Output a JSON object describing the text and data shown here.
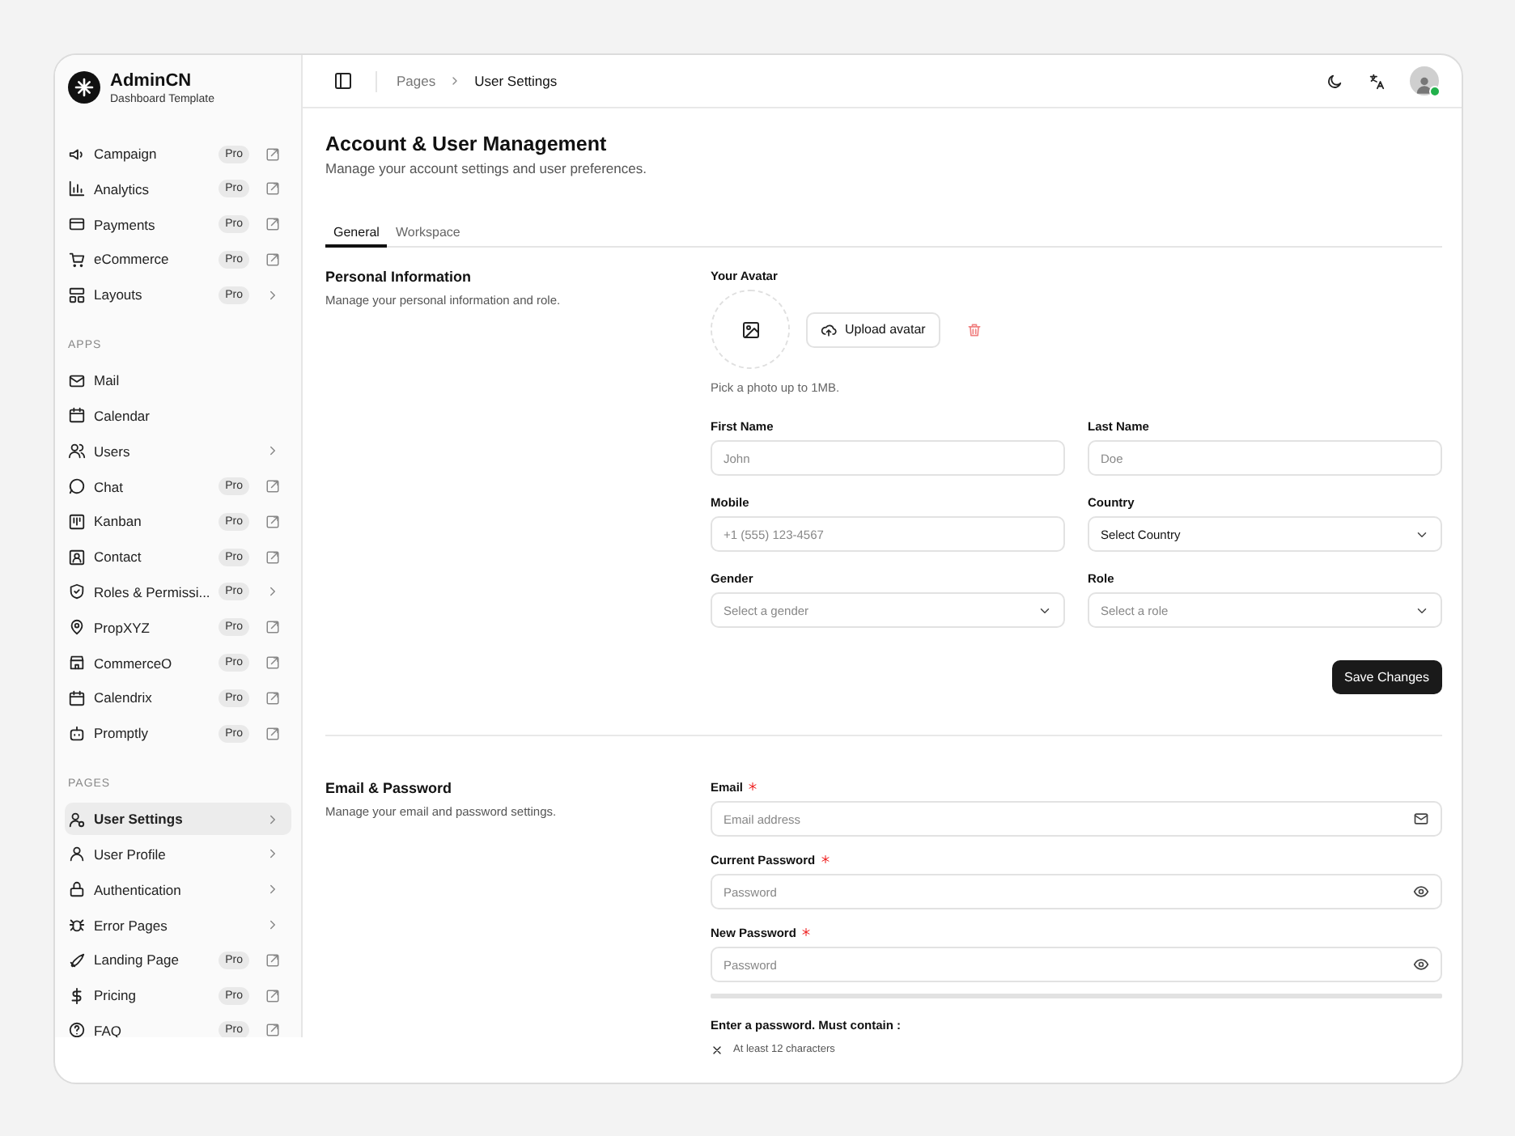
{
  "brand": {
    "name": "AdminCN",
    "tagline": "Dashboard Template"
  },
  "sidebar": {
    "sections": [
      {
        "items": [
          {
            "label": "Campaign",
            "badge": "Pro",
            "kind": "external",
            "selected": false
          },
          {
            "label": "Analytics",
            "badge": "Pro",
            "kind": "external",
            "selected": false
          },
          {
            "label": "Payments",
            "badge": "Pro",
            "kind": "external",
            "selected": false
          },
          {
            "label": "eCommerce",
            "badge": "Pro",
            "kind": "external",
            "selected": false
          },
          {
            "label": "Layouts",
            "badge": "Pro",
            "kind": "submenu",
            "selected": false
          }
        ]
      },
      {
        "title": "APPS",
        "items": [
          {
            "label": "Mail",
            "selected": false
          },
          {
            "label": "Calendar",
            "selected": false
          },
          {
            "label": "Users",
            "kind": "submenu",
            "selected": false
          },
          {
            "label": "Chat",
            "badge": "Pro",
            "kind": "external",
            "selected": false
          },
          {
            "label": "Kanban",
            "badge": "Pro",
            "kind": "external",
            "selected": false
          },
          {
            "label": "Contact",
            "badge": "Pro",
            "kind": "external",
            "selected": false
          },
          {
            "label": "Roles & Permissi...",
            "badge": "Pro",
            "kind": "submenu",
            "selected": false
          },
          {
            "label": "PropXYZ",
            "badge": "Pro",
            "kind": "external",
            "selected": false
          },
          {
            "label": "CommerceO",
            "badge": "Pro",
            "kind": "external",
            "selected": false
          },
          {
            "label": "Calendrix",
            "badge": "Pro",
            "kind": "external",
            "selected": false
          },
          {
            "label": "Promptly",
            "badge": "Pro",
            "kind": "external",
            "selected": false
          }
        ]
      },
      {
        "title": "PAGES",
        "items": [
          {
            "label": "User Settings",
            "kind": "submenu",
            "selected": true
          },
          {
            "label": "User Profile",
            "kind": "submenu",
            "selected": false
          },
          {
            "label": "Authentication",
            "kind": "submenu",
            "selected": false
          },
          {
            "label": "Error Pages",
            "kind": "submenu",
            "selected": false
          },
          {
            "label": "Landing Page",
            "badge": "Pro",
            "kind": "external",
            "selected": false
          },
          {
            "label": "Pricing",
            "badge": "Pro",
            "kind": "external",
            "selected": false
          },
          {
            "label": "FAQ",
            "badge": "Pro",
            "kind": "external",
            "selected": false
          }
        ]
      }
    ]
  },
  "header": {
    "breadcrumb": [
      "Pages",
      "User Settings"
    ],
    "user": {
      "online": true
    }
  },
  "page": {
    "title": "Account & User Management",
    "subtitle": "Manage your account settings and user preferences."
  },
  "tabs": [
    {
      "label": "General",
      "selected": true
    },
    {
      "label": "Workspace",
      "selected": false
    }
  ],
  "personal": {
    "title": "Personal Information",
    "description": "Manage your personal information and role.",
    "avatar": {
      "label": "Your Avatar",
      "upload": "Upload avatar",
      "hint": "Pick a photo up to 1MB."
    },
    "fields": [
      {
        "label": "First Name",
        "kind": "input",
        "placeholder": "John"
      },
      {
        "label": "Last Name",
        "kind": "input",
        "placeholder": "Doe"
      },
      {
        "label": "Mobile",
        "kind": "input",
        "placeholder": "+1 (555) 123-4567"
      },
      {
        "label": "Country",
        "kind": "select",
        "value": "Select Country"
      },
      {
        "label": "Gender",
        "kind": "select",
        "placeholder": "Select a gender"
      },
      {
        "label": "Role",
        "kind": "select",
        "placeholder": "Select a role"
      }
    ],
    "save": "Save Changes"
  },
  "security": {
    "title": "Email & Password",
    "description": "Manage your email and password settings.",
    "fields": [
      {
        "label": "Email",
        "required": true,
        "kind": "email",
        "placeholder": "Email address"
      },
      {
        "label": "Current Password",
        "required": true,
        "kind": "password",
        "placeholder": "Password"
      },
      {
        "label": "New Password",
        "required": true,
        "kind": "password",
        "placeholder": "Password"
      }
    ],
    "strength": {
      "level": 0
    },
    "rules_title": "Enter a password. Must contain :",
    "rules": [
      {
        "text": "At least 12 characters",
        "met": false
      }
    ]
  }
}
